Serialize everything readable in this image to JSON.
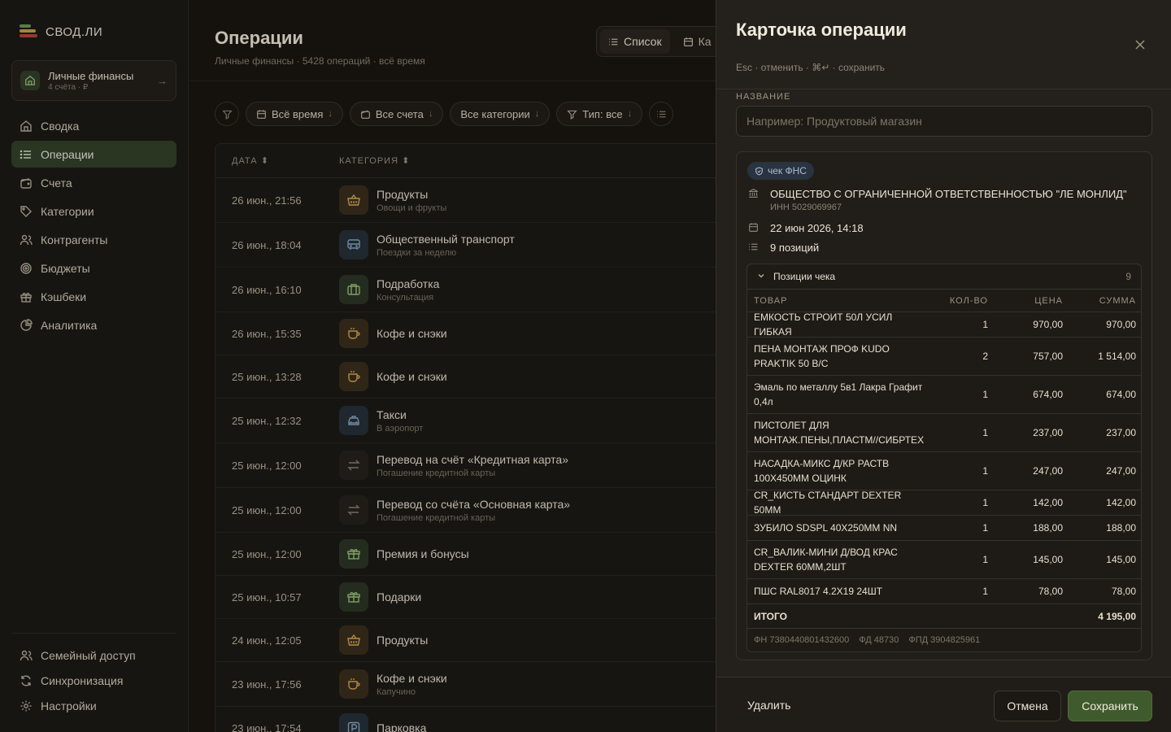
{
  "app": {
    "logo": "СВОД.ЛИ"
  },
  "workspace": {
    "title": "Личные финансы",
    "subtitle": "4 счёта · ₽"
  },
  "nav": [
    {
      "label": "Сводка",
      "icon": "home-icon"
    },
    {
      "label": "Операции",
      "icon": "list-icon",
      "active": true
    },
    {
      "label": "Счета",
      "icon": "wallet-icon"
    },
    {
      "label": "Категории",
      "icon": "tag-icon"
    },
    {
      "label": "Контрагенты",
      "icon": "users-icon"
    },
    {
      "label": "Бюджеты",
      "icon": "target-icon"
    },
    {
      "label": "Кэшбеки",
      "icon": "gift-icon"
    },
    {
      "label": "Аналитика",
      "icon": "pie-chart-icon"
    }
  ],
  "nav_bottom": [
    {
      "label": "Семейный доступ",
      "icon": "users-icon"
    },
    {
      "label": "Синхронизация",
      "icon": "sync-icon"
    },
    {
      "label": "Настройки",
      "icon": "gear-icon"
    }
  ],
  "main": {
    "title": "Операции",
    "subtitle": "Личные финансы · 5428 операций · всё время",
    "view_switch": {
      "list": "Список",
      "calendar": "Ка"
    },
    "filters": {
      "period": "Всё время",
      "accounts": "Все счета",
      "categories": "Все категории",
      "type": "Тип: все"
    },
    "columns": {
      "date": "ДАТА",
      "category": "КАТЕГОРИЯ"
    },
    "rows": [
      {
        "date": "26 июн., 21:56",
        "name": "Продукты",
        "note": "Овощи и фрукты",
        "kind": "food"
      },
      {
        "date": "26 июн., 18:04",
        "name": "Общественный транспорт",
        "note": "Поездки за неделю",
        "kind": "bus"
      },
      {
        "date": "26 июн., 16:10",
        "name": "Подработка",
        "note": "Консультация",
        "kind": "work"
      },
      {
        "date": "26 июн., 15:35",
        "name": "Кофе и снэки",
        "note": "",
        "kind": "coffee"
      },
      {
        "date": "25 июн., 13:28",
        "name": "Кофе и снэки",
        "note": "",
        "kind": "coffee"
      },
      {
        "date": "25 июн., 12:32",
        "name": "Такси",
        "note": "В аэропорт",
        "kind": "taxi"
      },
      {
        "date": "25 июн., 12:00",
        "name": "Перевод на счёт «Кредитная карта»",
        "note": "Погашение кредитной карты",
        "kind": "transfer"
      },
      {
        "date": "25 июн., 12:00",
        "name": "Перевод со счёта «Основная карта»",
        "note": "Погашение кредитной карты",
        "kind": "transfer"
      },
      {
        "date": "25 июн., 12:00",
        "name": "Премия и бонусы",
        "note": "",
        "kind": "gift"
      },
      {
        "date": "25 июн., 10:57",
        "name": "Подарки",
        "note": "",
        "kind": "gift"
      },
      {
        "date": "24 июн., 12:05",
        "name": "Продукты",
        "note": "",
        "kind": "food"
      },
      {
        "date": "23 июн., 17:56",
        "name": "Кофе и снэки",
        "note": "Капучино",
        "kind": "coffee"
      },
      {
        "date": "23 июн., 17:54",
        "name": "Парковка",
        "note": "",
        "kind": "park"
      }
    ]
  },
  "drawer": {
    "title": "Карточка операции",
    "hint": "Esc · отменить · ⌘↵ · сохранить",
    "name_label": "НАЗВАНИЕ",
    "name_placeholder": "Например: Продуктовый магазин",
    "name_value": "",
    "receipt": {
      "badge": "чек ФНС",
      "seller": "ОБЩЕСТВО С ОГРАНИЧЕННОЙ ОТВЕТСТВЕННОСТЬЮ \"ЛЕ МОНЛИД\"",
      "inn": "ИНН 5029069967",
      "datetime": "22 июн 2026, 14:18",
      "positions": "9 позиций",
      "items_title": "Позиции чека",
      "items_count": "9",
      "columns": {
        "good": "ТОВАР",
        "qty": "КОЛ-ВО",
        "price": "ЦЕНА",
        "sum": "СУММА"
      },
      "items": [
        {
          "good": "ЕМКОСТЬ СТРОИТ 50Л УСИЛ ГИБКАЯ",
          "qty": "1",
          "price": "970,00",
          "sum": "970,00"
        },
        {
          "good": "ПЕНА МОНТАЖ ПРОФ KUDO PRAKTIK 50 В/С",
          "qty": "2",
          "price": "757,00",
          "sum": "1 514,00"
        },
        {
          "good": "Эмаль по металлу 5в1 Лакра Графит 0,4л",
          "qty": "1",
          "price": "674,00",
          "sum": "674,00"
        },
        {
          "good": "ПИСТОЛЕТ ДЛЯ МОНТАЖ.ПЕНЫ,ПЛАСТМ//СИБРТЕХ",
          "qty": "1",
          "price": "237,00",
          "sum": "237,00"
        },
        {
          "good": "НАСАДКА-МИКС Д/КР РАСТВ 100Х450ММ ОЦИНК",
          "qty": "1",
          "price": "247,00",
          "sum": "247,00"
        },
        {
          "good": "CR_КИСТЬ СТАНДАРТ DEXTER 50ММ",
          "qty": "1",
          "price": "142,00",
          "sum": "142,00"
        },
        {
          "good": "ЗУБИЛО SDSPL 40Х250ММ NN",
          "qty": "1",
          "price": "188,00",
          "sum": "188,00"
        },
        {
          "good": "CR_ВАЛИК-МИНИ Д/ВОД КРАС DEXTER 60ММ,2ШТ",
          "qty": "1",
          "price": "145,00",
          "sum": "145,00"
        },
        {
          "good": "ПШС RAL8017 4.2Х19 24ШТ",
          "qty": "1",
          "price": "78,00",
          "sum": "78,00"
        }
      ],
      "total_label": "ИТОГО",
      "total": "4 195,00",
      "fn": "ФН 7380440801432600",
      "fd": "ФД 48730",
      "fpd": "ФПД 3904825961"
    },
    "delete": "Удалить",
    "cancel": "Отмена",
    "save": "Сохранить"
  },
  "colors": {
    "accent": "#3f5a2d",
    "active_nav": "#34412a",
    "badge": "#2a3340"
  }
}
